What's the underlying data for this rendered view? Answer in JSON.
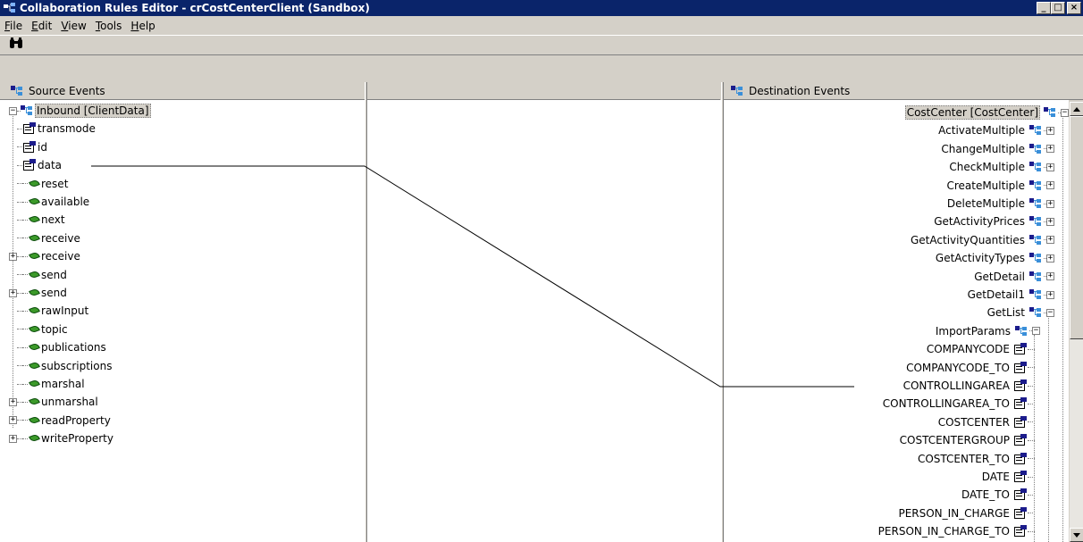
{
  "window": {
    "title": "Collaboration Rules Editor - crCostCenterClient (Sandbox)"
  },
  "window_buttons": {
    "minimize": "_",
    "maximize": "□",
    "close": "×"
  },
  "menu": [
    {
      "label": "File",
      "mnemonic": "F",
      "rest": "ile"
    },
    {
      "label": "Edit",
      "mnemonic": "E",
      "rest": "dit"
    },
    {
      "label": "View",
      "mnemonic": "V",
      "rest": "iew"
    },
    {
      "label": "Tools",
      "mnemonic": "T",
      "rest": "ools"
    },
    {
      "label": "Help",
      "mnemonic": "H",
      "rest": "elp"
    }
  ],
  "toolbar": {
    "find_icon": "binoculars-icon"
  },
  "source": {
    "header": "Source Events",
    "root": "Inbound [ClientData]",
    "items": [
      {
        "label": "transmode",
        "icon": "field",
        "expandable": false
      },
      {
        "label": "id",
        "icon": "field",
        "expandable": false
      },
      {
        "label": "data",
        "icon": "field",
        "expandable": false
      },
      {
        "label": "reset",
        "icon": "method",
        "expandable": false
      },
      {
        "label": "available",
        "icon": "method",
        "expandable": false
      },
      {
        "label": "next",
        "icon": "method",
        "expandable": false
      },
      {
        "label": "receive",
        "icon": "method",
        "expandable": false
      },
      {
        "label": "receive",
        "icon": "method",
        "expandable": true
      },
      {
        "label": "send",
        "icon": "method",
        "expandable": false
      },
      {
        "label": "send",
        "icon": "method",
        "expandable": true
      },
      {
        "label": "rawInput",
        "icon": "method",
        "expandable": false
      },
      {
        "label": "topic",
        "icon": "method",
        "expandable": false
      },
      {
        "label": "publications",
        "icon": "method",
        "expandable": false
      },
      {
        "label": "subscriptions",
        "icon": "method",
        "expandable": false
      },
      {
        "label": "marshal",
        "icon": "method",
        "expandable": false
      },
      {
        "label": "unmarshal",
        "icon": "method",
        "expandable": true
      },
      {
        "label": "readProperty",
        "icon": "method",
        "expandable": true
      },
      {
        "label": "writeProperty",
        "icon": "method",
        "expandable": true
      }
    ]
  },
  "destination": {
    "header": "Destination Events",
    "root": "CostCenter [CostCenter]",
    "methods": [
      {
        "label": "ActivateMultiple",
        "expanded": false
      },
      {
        "label": "ChangeMultiple",
        "expanded": false
      },
      {
        "label": "CheckMultiple",
        "expanded": false
      },
      {
        "label": "CreateMultiple",
        "expanded": false
      },
      {
        "label": "DeleteMultiple",
        "expanded": false
      },
      {
        "label": "GetActivityPrices",
        "expanded": false
      },
      {
        "label": "GetActivityQuantities",
        "expanded": false
      },
      {
        "label": "GetActivityTypes",
        "expanded": false
      },
      {
        "label": "GetDetail",
        "expanded": false
      },
      {
        "label": "GetDetail1",
        "expanded": false
      },
      {
        "label": "GetList",
        "expanded": true
      }
    ],
    "subgroup": "ImportParams",
    "fields": [
      "COMPANYCODE",
      "COMPANYCODE_TO",
      "CONTROLLINGAREA",
      "CONTROLLINGAREA_TO",
      "COSTCENTER",
      "COSTCENTERGROUP",
      "COSTCENTER_TO",
      "DATE",
      "DATE_TO",
      "PERSON_IN_CHARGE",
      "PERSON_IN_CHARGE_TO"
    ]
  },
  "mapping": {
    "from": "data",
    "to": "CONTROLLINGAREA"
  }
}
